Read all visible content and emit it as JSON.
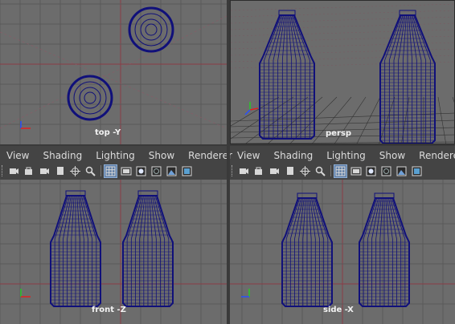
{
  "viewports": {
    "top": {
      "label": "top -Y"
    },
    "persp": {
      "label": "persp"
    },
    "front": {
      "label": "front -Z"
    },
    "side": {
      "label": "side -X"
    }
  },
  "panel_menu": [
    "View",
    "Shading",
    "Lighting",
    "Show",
    "Renderer"
  ],
  "toolbar_icons": [
    "camera-icon",
    "camera-lock-icon",
    "camera-icon",
    "bookmark-icon",
    "crosshair-icon",
    "zoom-icon",
    "grid-icon",
    "film-gate-icon",
    "smooth-shade-icon",
    "wireframe-icon",
    "textured-icon",
    "resolution-gate-icon"
  ],
  "colors": {
    "viewport_bg": "#6c6c6c",
    "wireframe": "#10107a",
    "grid": "#5a5a5a",
    "origin_axis": "#8a3c46",
    "menu_bg": "#444444",
    "axis_x": "#e02020",
    "axis_y": "#28c828",
    "axis_z": "#2850ff"
  }
}
